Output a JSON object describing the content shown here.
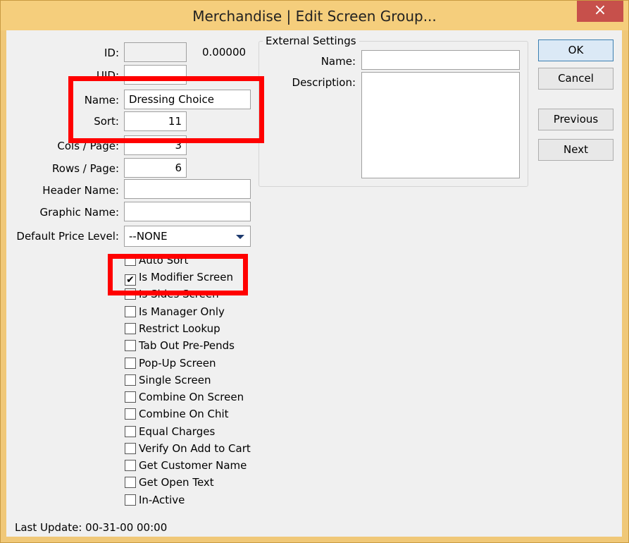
{
  "window": {
    "title": "Merchandise | Edit Screen Group...",
    "close_glyph": "×"
  },
  "form": {
    "id": {
      "label": "ID:",
      "value": "",
      "extra": "0.00000"
    },
    "uid": {
      "label": "UID:",
      "value": ""
    },
    "name": {
      "label": "Name:",
      "value": "Dressing Choice"
    },
    "sort": {
      "label": "Sort:",
      "value": "11"
    },
    "cols": {
      "label": "Cols / Page:",
      "value": "3"
    },
    "rows": {
      "label": "Rows / Page:",
      "value": "6"
    },
    "header_name": {
      "label": "Header Name:",
      "value": ""
    },
    "graphic_name": {
      "label": "Graphic Name:",
      "value": ""
    },
    "price_level": {
      "label": "Default Price Level:",
      "value": "--NONE"
    }
  },
  "checkboxes": [
    {
      "label": "Auto Sort",
      "checked": false
    },
    {
      "label": "Is Modifier Screen",
      "checked": true
    },
    {
      "label": "Is Sides Screen",
      "checked": false
    },
    {
      "label": "Is Manager Only",
      "checked": false
    },
    {
      "label": "Restrict Lookup",
      "checked": false
    },
    {
      "label": "Tab Out Pre-Pends",
      "checked": false
    },
    {
      "label": "Pop-Up Screen",
      "checked": false
    },
    {
      "label": "Single Screen",
      "checked": false
    },
    {
      "label": "Combine On Screen",
      "checked": false
    },
    {
      "label": "Combine On Chit",
      "checked": false
    },
    {
      "label": "Equal Charges",
      "checked": false
    },
    {
      "label": "Verify On Add to Cart",
      "checked": false
    },
    {
      "label": "Get Customer Name",
      "checked": false
    },
    {
      "label": "Get Open Text",
      "checked": false
    },
    {
      "label": "In-Active",
      "checked": false
    }
  ],
  "external": {
    "title": "External Settings",
    "name_label": "Name:",
    "name_value": "",
    "desc_label": "Description:",
    "desc_value": ""
  },
  "buttons": {
    "ok": "OK",
    "cancel": "Cancel",
    "previous": "Previous",
    "next": "Next"
  },
  "footer": {
    "last_update": "Last Update: 00-31-00 00:00"
  },
  "colors": {
    "title_bar": "#f5ce7c",
    "close": "#c7504b",
    "highlight": "#ff0000"
  }
}
